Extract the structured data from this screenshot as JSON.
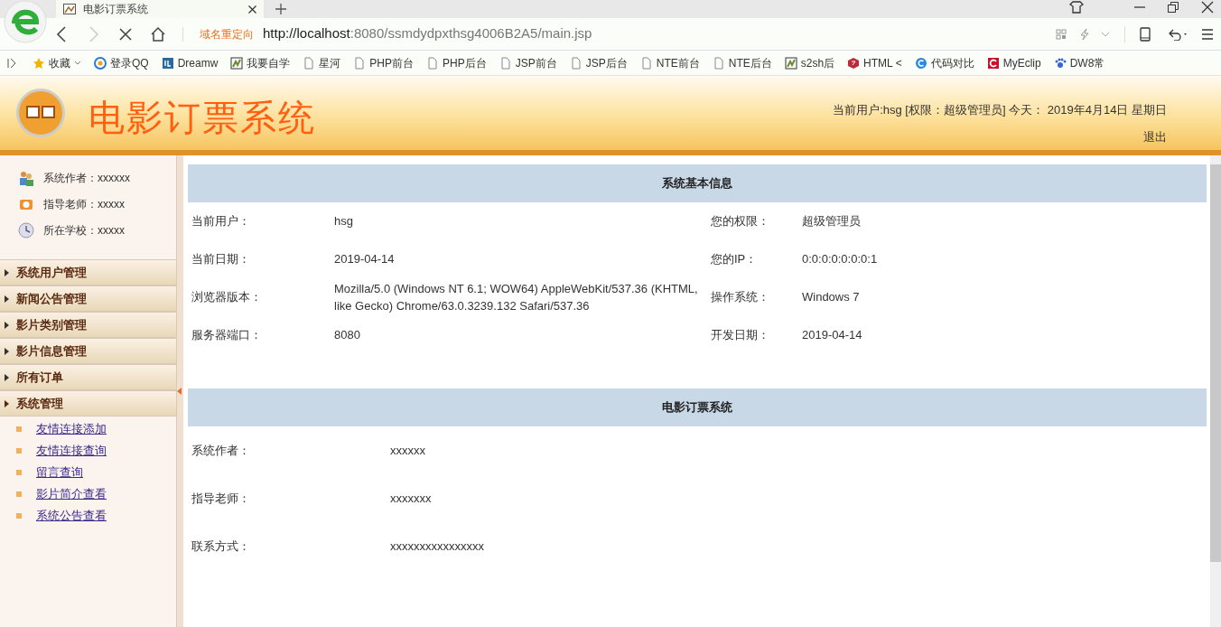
{
  "browser": {
    "tab_title": "电影订票系统",
    "redirect_label": "域名重定向",
    "url_host": "http://localhost",
    "url_rest": ":8080/ssmdydpxthsg4006B2A5/main.jsp",
    "bookmarks": [
      {
        "label": "收藏",
        "kind": "star"
      },
      {
        "label": "登录QQ",
        "kind": "qq"
      },
      {
        "label": "Dreamw",
        "kind": "dw"
      },
      {
        "label": "我要自学",
        "kind": "pic"
      },
      {
        "label": "星河",
        "kind": "page"
      },
      {
        "label": "PHP前台",
        "kind": "page"
      },
      {
        "label": "PHP后台",
        "kind": "page"
      },
      {
        "label": "JSP前台",
        "kind": "page"
      },
      {
        "label": "JSP后台",
        "kind": "page"
      },
      {
        "label": "NTE前台",
        "kind": "page"
      },
      {
        "label": "NTE后台",
        "kind": "page"
      },
      {
        "label": "s2sh后",
        "kind": "pic"
      },
      {
        "label": "HTML <",
        "kind": "html"
      },
      {
        "label": "代码对比",
        "kind": "circle"
      },
      {
        "label": "MyEclip",
        "kind": "red"
      },
      {
        "label": "DW8常",
        "kind": "paw"
      }
    ]
  },
  "header": {
    "title": "电影订票系统",
    "user_info": "当前用户:hsg [权限：超级管理员] 今天： 2019年4月14日 星期日",
    "logout": "退出"
  },
  "sidebar": {
    "info": [
      {
        "label": "系统作者：xxxxxx",
        "kind": "people"
      },
      {
        "label": "指导老师：xxxxx",
        "kind": "teacher"
      },
      {
        "label": "所在学校：xxxxx",
        "kind": "clock"
      }
    ],
    "menu": [
      {
        "label": "系统用户管理",
        "expanded": false
      },
      {
        "label": "新闻公告管理",
        "expanded": false
      },
      {
        "label": "影片类别管理",
        "expanded": false
      },
      {
        "label": "影片信息管理",
        "expanded": false
      },
      {
        "label": "所有订单",
        "expanded": false
      },
      {
        "label": "系统管理",
        "expanded": true,
        "children": [
          "友情连接添加",
          "友情连接查询",
          "留言查询",
          "影片简介查看",
          "系统公告查看"
        ]
      }
    ]
  },
  "sections": [
    {
      "title": "系统基本信息",
      "rows": [
        {
          "cells": [
            "当前用户：",
            "hsg",
            "您的权限：",
            "超级管理员"
          ]
        },
        {
          "cells": [
            "当前日期：",
            "2019-04-14",
            "您的IP：",
            "0:0:0:0:0:0:0:1"
          ]
        },
        {
          "cells": [
            "浏览器版本：",
            "Mozilla/5.0 (Windows NT 6.1; WOW64) AppleWebKit/537.36 (KHTML, like Gecko) Chrome/63.0.3239.132 Safari/537.36",
            "操作系统：",
            "Windows 7"
          ]
        },
        {
          "cells": [
            "服务器端口：",
            "8080",
            "开发日期：",
            "2019-04-14"
          ]
        }
      ]
    },
    {
      "title": "电影订票系统",
      "rows": [
        {
          "cells": [
            "系统作者：",
            "xxxxxx"
          ]
        },
        {
          "cells": [
            "指导老师：",
            "xxxxxxx"
          ]
        },
        {
          "cells": [
            "联系方式：",
            "xxxxxxxxxxxxxxxx"
          ]
        }
      ]
    }
  ]
}
